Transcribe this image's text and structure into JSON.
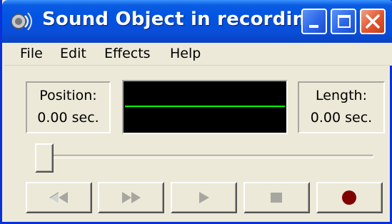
{
  "window": {
    "title": "Sound Object in recordin...",
    "controls": {
      "minimize_icon": "minimize-icon",
      "maximize_icon": "maximize-icon",
      "close_icon": "close-icon"
    },
    "app_icon": "speaker-icon"
  },
  "menu": {
    "items": [
      {
        "label": "File"
      },
      {
        "label": "Edit"
      },
      {
        "label": "Effects"
      },
      {
        "label": "Help"
      }
    ]
  },
  "position": {
    "label": "Position:",
    "value": "0.00 sec."
  },
  "length": {
    "label": "Length:",
    "value": "0.00 sec."
  },
  "waveform": {
    "background": "#000000",
    "line_color": "#00ff00"
  },
  "slider": {
    "value": 0
  },
  "transport": [
    {
      "name": "seek-to-start",
      "icon": "rewind-icon",
      "enabled": false
    },
    {
      "name": "seek-to-end",
      "icon": "fast-forward-icon",
      "enabled": false
    },
    {
      "name": "play",
      "icon": "play-icon",
      "enabled": false
    },
    {
      "name": "stop",
      "icon": "stop-icon",
      "enabled": false
    },
    {
      "name": "record",
      "icon": "record-icon",
      "enabled": true,
      "color": "#800000"
    }
  ],
  "colors": {
    "titlebar": "#0054e3",
    "window_bg": "#ece9d8",
    "disabled_glyph": "#a7a6a0"
  }
}
